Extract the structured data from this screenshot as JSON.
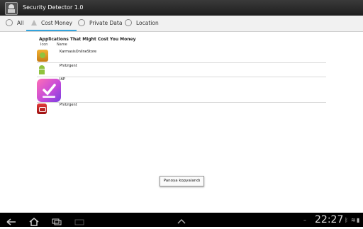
{
  "app": {
    "title": "Security Detector 1.0"
  },
  "tabs": [
    {
      "label": "All"
    },
    {
      "label": "Cost Money"
    },
    {
      "label": "Private Data"
    },
    {
      "label": "Location"
    }
  ],
  "section": {
    "heading": "Applications That Might Cost You Money",
    "col_icon": "Icon",
    "col_name": "Name"
  },
  "apps": [
    {
      "name": "KarmasisOnlineStore",
      "icon": "android-store-icon"
    },
    {
      "name": "PhiUrgent",
      "icon": "android-robot-icon"
    },
    {
      "name": "IAP",
      "icon": "checkmark-app-icon"
    },
    {
      "name": "PhiUrgent",
      "icon": "red-phone-icon"
    }
  ],
  "toast": {
    "text": "Panoya kopyalandı"
  },
  "status": {
    "clock": "22:27"
  },
  "colors": {
    "accent": "#33a3dc",
    "titlebar": "#2a2a2a"
  }
}
